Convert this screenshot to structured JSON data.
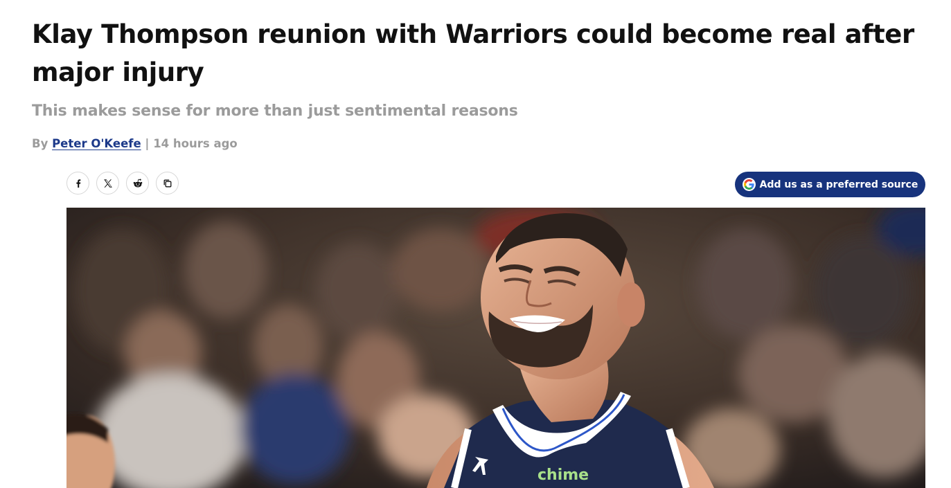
{
  "article": {
    "headline": "Klay Thompson reunion with Warriors could become real after major injury",
    "subheadline": "This makes sense for more than just sentimental reasons",
    "byline": {
      "prefix": "By",
      "author": "Peter O'Keefe",
      "separator": "|",
      "timestamp": "14 hours ago"
    }
  },
  "share": {
    "buttons": [
      {
        "icon": "facebook-icon",
        "glyph": "f"
      },
      {
        "icon": "x-icon",
        "glyph": "𝕏"
      },
      {
        "icon": "reddit-icon"
      },
      {
        "icon": "copy-link-icon"
      }
    ]
  },
  "preferred_source": {
    "label": "Add us as a preferred source",
    "icon": "google-icon"
  },
  "hero_image": {
    "jersey_sponsor": "chime"
  },
  "colors": {
    "headline": "#111111",
    "subheadline": "#9b9b9b",
    "author_link": "#1d3a8a",
    "preferred_button_bg": "#17337d",
    "jersey_navy": "#1f2a4d",
    "sponsor_green": "#a8e08a"
  }
}
